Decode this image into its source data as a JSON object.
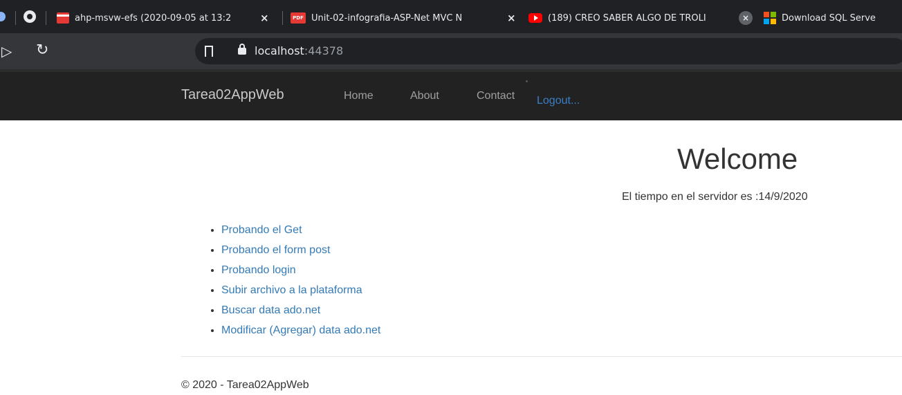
{
  "browser": {
    "tabs": [
      {
        "title": "ahp-msvw-efs (2020-09-05 at 13:2",
        "icon": "clapperboard-icon",
        "close": "×"
      },
      {
        "title": "Unit-02-infografia-ASP-Net MVC N",
        "icon": "pdf-icon",
        "icon_text": "PDF",
        "close": "×"
      },
      {
        "title": "(189) CREO SABER ALGO DE TROLI",
        "icon": "youtube-icon",
        "close": "×"
      },
      {
        "title": "Download SQL Serve",
        "icon": "microsoft-icon"
      }
    ],
    "url_host": "localhost",
    "url_port": ":44378",
    "colors": {
      "tab_strip": "#202124",
      "toolbar": "#35363a",
      "omnibox": "#202124"
    }
  },
  "navbar": {
    "brand": "Tarea02AppWeb",
    "links": [
      "Home",
      "About",
      "Contact"
    ],
    "logout": "Logout...",
    "colors": {
      "background": "#222222",
      "link": "#a0a0a0",
      "logout": "#3a7fc8"
    }
  },
  "main": {
    "heading": "Welcome",
    "server_time": "El tiempo en el servidor es :14/9/2020",
    "links": [
      "Probando el Get",
      "Probando el form post",
      "Probando login",
      "Subir archivo a la plataforma",
      "Buscar data ado.net",
      "Modificar (Agregar) data ado.net"
    ],
    "link_color": "#337ab7"
  },
  "footer": {
    "text": "© 2020 - Tarea02AppWeb"
  }
}
